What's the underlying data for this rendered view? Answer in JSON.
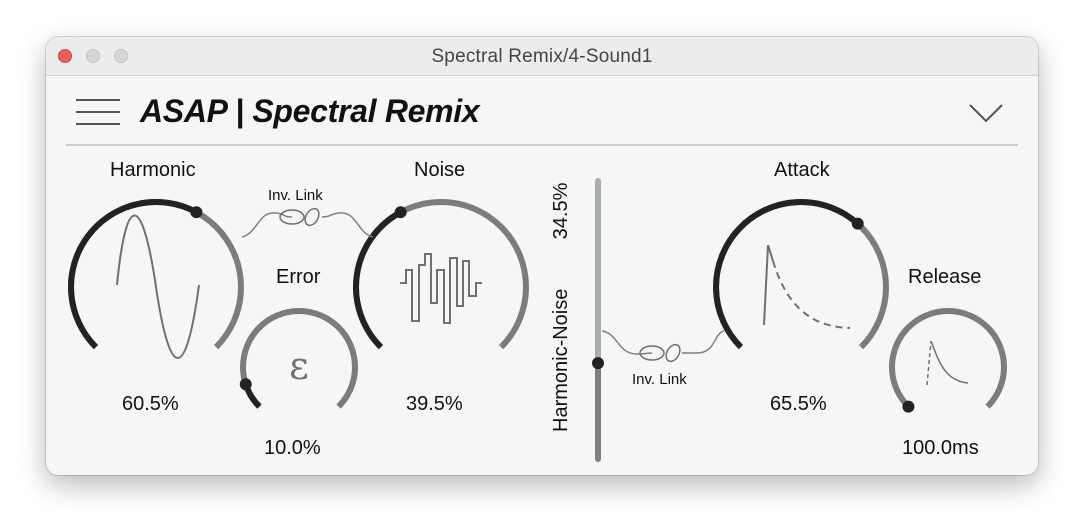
{
  "window": {
    "title": "Spectral Remix/4-Sound1"
  },
  "header": {
    "title": "ASAP | Spectral Remix"
  },
  "knobs": {
    "harmonic": {
      "label": "Harmonic",
      "value": "60.5%",
      "level": 0.605
    },
    "error": {
      "label": "Error",
      "value": "10.0%",
      "level": 0.1
    },
    "noise": {
      "label": "Noise",
      "value": "39.5%",
      "level": 0.395
    },
    "attack": {
      "label": "Attack",
      "value": "65.5%",
      "level": 0.655
    },
    "release": {
      "label": "Release",
      "value": "100.0ms",
      "level": 0.0
    }
  },
  "link_left": {
    "label": "Inv. Link"
  },
  "link_right": {
    "label": "Inv. Link"
  },
  "slider": {
    "label": "Harmonic-Noise",
    "value": "34.5%",
    "level": 0.345
  },
  "colors": {
    "arc_active": "#222226",
    "arc_inactive": "#7c7c7c",
    "slider_upper": "#a8aeae",
    "slider_lower": "#808080",
    "icon_stroke": "#707070"
  },
  "icons": {
    "menu": "hamburger-icon",
    "collapse": "chevron-down-icon",
    "link": "chain-link-icon"
  }
}
